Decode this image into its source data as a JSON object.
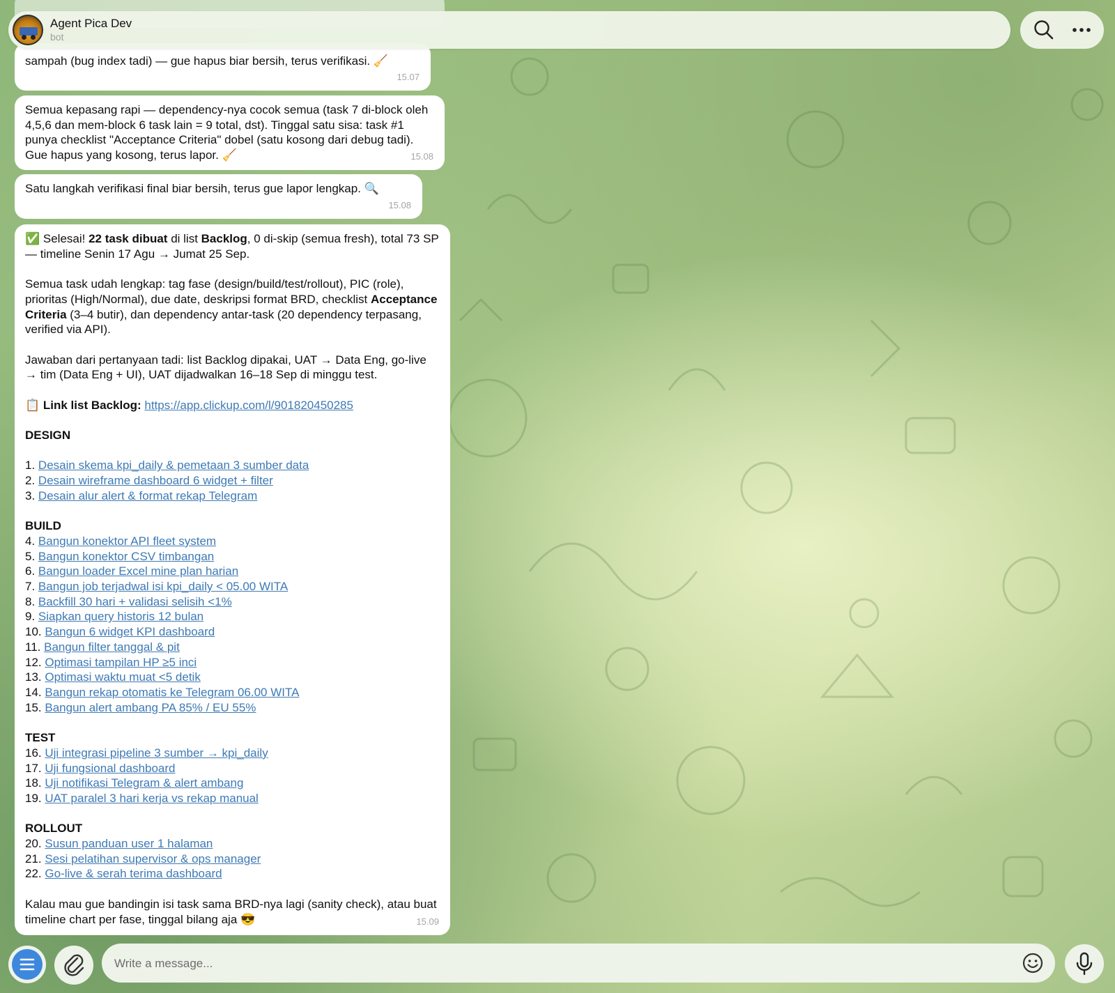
{
  "header": {
    "title": "Agent Pica Dev",
    "subtitle": "bot",
    "search_icon": "search-icon",
    "more_icon": "more-icon"
  },
  "messages": {
    "m1": {
      "text": "sampah (bug index tadi) — gue hapus biar bersih, terus verifikasi. 🧹",
      "time": "15.07"
    },
    "m2": {
      "text": "Semua kepasang rapi — dependency-nya cocok semua (task 7 di-block oleh 4,5,6 dan mem-block 6 task lain = 9 total, dst). Tinggal satu sisa: task #1 punya checklist \"Acceptance Criteria\" dobel (satu kosong dari debug tadi). Gue hapus yang kosong, terus lapor. 🧹",
      "time": "15.08"
    },
    "m3": {
      "text": "Satu langkah verifikasi final biar bersih, terus gue lapor lengkap. 🔍",
      "time": "15.08"
    },
    "m4": {
      "time": "15.09",
      "p1": {
        "a": "✅ Selesai! ",
        "b": "22 task dibuat",
        "c": " di list ",
        "d": "Backlog",
        "e": ", 0 di-skip (semua fresh), total 73 SP — timeline Senin 17 Agu → Jumat 25 Sep."
      },
      "p2": {
        "a": "Semua task udah lengkap: tag fase (design/build/test/rollout), PIC (role), prioritas (High/Normal), due date, deskripsi format BRD, checklist ",
        "b": "Acceptance Criteria",
        "c": " (3–4 butir), dan dependency antar-task (20 dependency terpasang, verified via API)."
      },
      "p3": "Jawaban dari pertanyaan tadi: list Backlog dipakai, UAT → Data Eng, go-live → tim (Data Eng + UI), UAT dijadwalkan 16–18 Sep di minggu test.",
      "link_line": {
        "emoji": "📋 ",
        "label": "Link list Backlog:",
        "url": "https://app.clickup.com/l/901820450285"
      },
      "design": {
        "heading": "DESIGN",
        "items": [
          {
            "num": "1.",
            "text": "Desain skema kpi_daily & pemetaan 3 sumber data"
          },
          {
            "num": "2.",
            "text": "Desain wireframe dashboard 6 widget + filter"
          },
          {
            "num": "3.",
            "text": "Desain alur alert & format rekap Telegram"
          }
        ]
      },
      "build": {
        "heading": "BUILD",
        "items": [
          {
            "num": "4.",
            "text": "Bangun konektor API fleet system"
          },
          {
            "num": "5.",
            "text": "Bangun konektor CSV timbangan"
          },
          {
            "num": "6.",
            "text": "Bangun loader Excel mine plan harian"
          },
          {
            "num": "7.",
            "text": "Bangun job terjadwal isi kpi_daily < 05.00 WITA"
          },
          {
            "num": "8.",
            "text": "Backfill 30 hari + validasi selisih <1%"
          },
          {
            "num": "9.",
            "text": "Siapkan query historis 12 bulan"
          },
          {
            "num": "10.",
            "text": "Bangun 6 widget KPI dashboard"
          },
          {
            "num": "11.",
            "text": "Bangun filter tanggal & pit"
          },
          {
            "num": "12.",
            "text": "Optimasi tampilan HP ≥5 inci"
          },
          {
            "num": "13.",
            "text": "Optimasi waktu muat <5 detik"
          },
          {
            "num": "14.",
            "text": "Bangun rekap otomatis ke Telegram 06.00 WITA"
          },
          {
            "num": "15.",
            "text": "Bangun alert ambang PA 85% / EU 55%"
          }
        ]
      },
      "test": {
        "heading": "TEST",
        "items": [
          {
            "num": "16.",
            "text": "Uji integrasi pipeline 3 sumber → kpi_daily"
          },
          {
            "num": "17.",
            "text": "Uji fungsional dashboard"
          },
          {
            "num": "18.",
            "text": "Uji notifikasi Telegram & alert ambang"
          },
          {
            "num": "19.",
            "text": "UAT paralel 3 hari kerja vs rekap manual"
          }
        ]
      },
      "rollout": {
        "heading": "ROLLOUT",
        "items": [
          {
            "num": "20.",
            "text": "Susun panduan user 1 halaman"
          },
          {
            "num": "21.",
            "text": "Sesi pelatihan supervisor & ops manager"
          },
          {
            "num": "22.",
            "text": "Go-live & serah terima dashboard"
          }
        ]
      },
      "closing": "Kalau mau gue bandingin isi task sama BRD-nya lagi (sanity check), atau buat timeline chart per fase, tinggal bilang aja 😎"
    }
  },
  "composer": {
    "placeholder": "Write a message...",
    "menu_icon": "menu-icon",
    "attach_icon": "paperclip-icon",
    "emoji_icon": "emoji-icon",
    "mic_icon": "microphone-icon"
  },
  "colors": {
    "link": "#3e7ab5",
    "menu_button": "#3d88dd",
    "timestamp": "#a5a5a5"
  }
}
